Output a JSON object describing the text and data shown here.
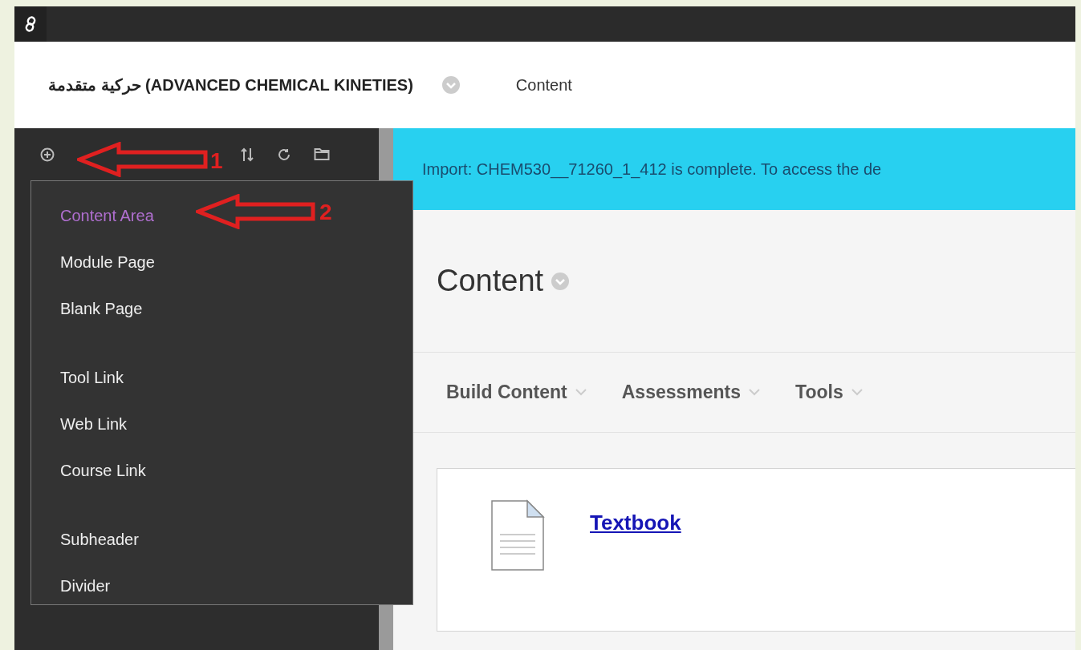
{
  "course_title": "حركية متقدمة (ADVANCED CHEMICAL KINETIES)",
  "breadcrumb": "Content",
  "banner": "Import: CHEM530__71260_1_412 is complete. To access the de",
  "page_title": "Content",
  "action_bar": [
    "Build Content",
    "Assessments",
    "Tools"
  ],
  "add_menu": {
    "groups": [
      [
        {
          "label": "Content Area",
          "selected": true
        },
        {
          "label": "Module Page",
          "selected": false
        },
        {
          "label": "Blank Page",
          "selected": false
        }
      ],
      [
        {
          "label": "Tool Link",
          "selected": false
        },
        {
          "label": "Web Link",
          "selected": false
        },
        {
          "label": "Course Link",
          "selected": false
        }
      ],
      [
        {
          "label": "Subheader",
          "selected": false
        },
        {
          "label": "Divider",
          "selected": false
        }
      ]
    ]
  },
  "annotations": [
    "1",
    "2"
  ],
  "items": [
    {
      "title": "Textbook"
    }
  ]
}
